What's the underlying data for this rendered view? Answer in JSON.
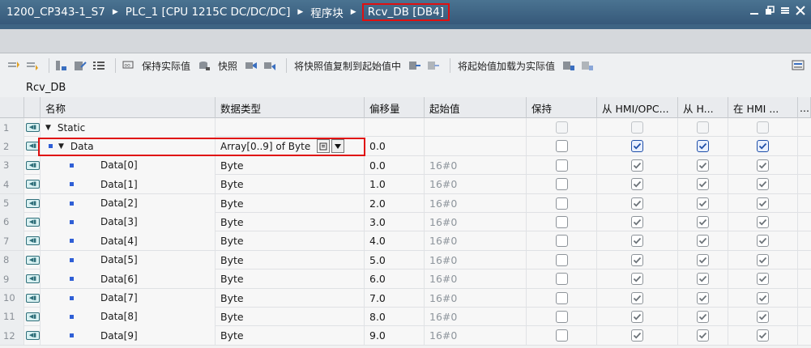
{
  "breadcrumb": [
    "1200_CP343-1_S7",
    "PLC_1 [CPU 1215C DC/DC/DC]",
    "程序块",
    "Rcv_DB [DB4]"
  ],
  "window_controls": [
    "minimize",
    "restore",
    "list",
    "close"
  ],
  "toolbar": {
    "keep_actual": "保持实际值",
    "snapshot": "快照",
    "copy_snapshot": "将快照值复制到起始值中",
    "load_start": "将起始值加载为实际值"
  },
  "block_title": "Rcv_DB",
  "columns": [
    "名称",
    "数据类型",
    "偏移量",
    "起始值",
    "保持",
    "从 HMI/OPC...",
    "从 H...",
    "在 HMI ...",
    "..."
  ],
  "rows": [
    {
      "num": "1",
      "name": "Static",
      "type": "",
      "offset": "",
      "start": "",
      "level": 0,
      "caret": "▼",
      "disabled": true
    },
    {
      "num": "2",
      "name": "Data",
      "type": "Array[0..9] of Byte",
      "offset": "0.0",
      "start": "",
      "level": 1,
      "caret": "▼",
      "disabled": false
    },
    {
      "num": "3",
      "name": "Data[0]",
      "type": "Byte",
      "offset": "0.0",
      "start": "16#0",
      "level": 2,
      "caret": "",
      "disabled": false
    },
    {
      "num": "4",
      "name": "Data[1]",
      "type": "Byte",
      "offset": "1.0",
      "start": "16#0",
      "level": 2,
      "caret": "",
      "disabled": false
    },
    {
      "num": "5",
      "name": "Data[2]",
      "type": "Byte",
      "offset": "2.0",
      "start": "16#0",
      "level": 2,
      "caret": "",
      "disabled": false
    },
    {
      "num": "6",
      "name": "Data[3]",
      "type": "Byte",
      "offset": "3.0",
      "start": "16#0",
      "level": 2,
      "caret": "",
      "disabled": false
    },
    {
      "num": "7",
      "name": "Data[4]",
      "type": "Byte",
      "offset": "4.0",
      "start": "16#0",
      "level": 2,
      "caret": "",
      "disabled": false
    },
    {
      "num": "8",
      "name": "Data[5]",
      "type": "Byte",
      "offset": "5.0",
      "start": "16#0",
      "level": 2,
      "caret": "",
      "disabled": false
    },
    {
      "num": "9",
      "name": "Data[6]",
      "type": "Byte",
      "offset": "6.0",
      "start": "16#0",
      "level": 2,
      "caret": "",
      "disabled": false
    },
    {
      "num": "10",
      "name": "Data[7]",
      "type": "Byte",
      "offset": "7.0",
      "start": "16#0",
      "level": 2,
      "caret": "",
      "disabled": false
    },
    {
      "num": "11",
      "name": "Data[8]",
      "type": "Byte",
      "offset": "8.0",
      "start": "16#0",
      "level": 2,
      "caret": "",
      "disabled": false
    },
    {
      "num": "12",
      "name": "Data[9]",
      "type": "Byte",
      "offset": "9.0",
      "start": "16#0",
      "level": 2,
      "caret": "",
      "disabled": false
    }
  ],
  "colors": {
    "titlebar": "#3f6788",
    "highlight_red": "#e01010",
    "bullet_blue": "#2f5fd6"
  },
  "icons": {
    "db": "db-icon",
    "caret": "caret-down-icon",
    "checkbox": "checkbox"
  }
}
